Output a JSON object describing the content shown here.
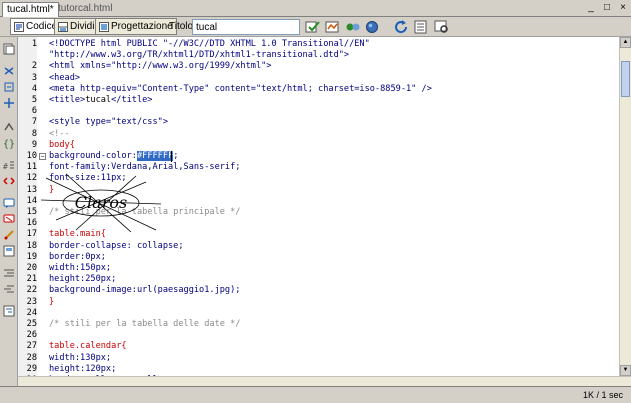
{
  "tabs": [
    {
      "label": "tucal.html*",
      "active": true
    },
    {
      "label": "tutorcal.html",
      "active": false
    }
  ],
  "window_buttons": [
    "_",
    "□",
    "×"
  ],
  "toolbar": {
    "code_label": "Codice",
    "split_label": "Dividi",
    "design_label": "Progettazione",
    "title_label": "Titolo:",
    "title_value": "tucal"
  },
  "editor": {
    "lines": [
      {
        "n": "1",
        "parts": [
          {
            "t": "<!DOCTYPE html PUBLIC \"-//W3C//DTD XHTML 1.0 Transitional//EN\"",
            "c": "tag"
          }
        ]
      },
      {
        "n": "",
        "parts": [
          {
            "t": "\"http://www.w3.org/TR/xhtml1/DTD/xhtml1-transitional.dtd\">",
            "c": "tag"
          }
        ]
      },
      {
        "n": "2",
        "parts": [
          {
            "t": "<html xmlns=\"http://www.w3.org/1999/xhtml\">",
            "c": "tag"
          }
        ]
      },
      {
        "n": "3",
        "parts": [
          {
            "t": "<head>",
            "c": "tag"
          }
        ]
      },
      {
        "n": "4",
        "parts": [
          {
            "t": "<meta http-equiv=\"Content-Type\" content=\"text/html; charset=iso-8859-1\" />",
            "c": "tag"
          }
        ]
      },
      {
        "n": "5",
        "parts": [
          {
            "t": "<title>",
            "c": "tag"
          },
          {
            "t": "tucal",
            "c": "txt"
          },
          {
            "t": "</title>",
            "c": "tag"
          }
        ]
      },
      {
        "n": "6",
        "parts": []
      },
      {
        "n": "7",
        "parts": [
          {
            "t": "<style type=\"text/css\">",
            "c": "tag"
          }
        ]
      },
      {
        "n": "8",
        "parts": [
          {
            "t": "<!--",
            "c": "cm"
          }
        ]
      },
      {
        "n": "9",
        "parts": [
          {
            "t": "body{",
            "c": "css"
          }
        ]
      },
      {
        "n": "10",
        "fold": true,
        "parts": [
          {
            "t": "background-color:",
            "c": "prop"
          },
          {
            "t": "#FFFFFF",
            "c": "sel"
          },
          {
            "t": ";",
            "c": "prop"
          }
        ]
      },
      {
        "n": "11",
        "parts": [
          {
            "t": "font-family:Verdana,Arial,Sans-serif;",
            "c": "prop"
          }
        ]
      },
      {
        "n": "12",
        "parts": [
          {
            "t": "font-size:11px;",
            "c": "prop"
          }
        ]
      },
      {
        "n": "13",
        "parts": [
          {
            "t": "}",
            "c": "css"
          }
        ]
      },
      {
        "n": "14",
        "parts": []
      },
      {
        "n": "15",
        "parts": [
          {
            "t": "/* stili per la tabella principale */",
            "c": "cm"
          }
        ]
      },
      {
        "n": "16",
        "parts": []
      },
      {
        "n": "17",
        "parts": [
          {
            "t": "table.main{",
            "c": "css"
          }
        ]
      },
      {
        "n": "18",
        "parts": [
          {
            "t": "border-collapse: collapse;",
            "c": "prop"
          }
        ]
      },
      {
        "n": "19",
        "parts": [
          {
            "t": "border:0px;",
            "c": "prop"
          }
        ]
      },
      {
        "n": "20",
        "parts": [
          {
            "t": "width:150px;",
            "c": "prop"
          }
        ]
      },
      {
        "n": "21",
        "parts": [
          {
            "t": "height:250px;",
            "c": "prop"
          }
        ]
      },
      {
        "n": "22",
        "parts": [
          {
            "t": "background-image:url(paesaggio1.jpg);",
            "c": "prop"
          }
        ]
      },
      {
        "n": "23",
        "parts": [
          {
            "t": "}",
            "c": "css"
          }
        ]
      },
      {
        "n": "24",
        "parts": []
      },
      {
        "n": "25",
        "parts": [
          {
            "t": "/* stili per la tabella delle date */",
            "c": "cm"
          }
        ]
      },
      {
        "n": "26",
        "parts": []
      },
      {
        "n": "27",
        "parts": [
          {
            "t": "table.calendar{",
            "c": "css"
          }
        ]
      },
      {
        "n": "28",
        "parts": [
          {
            "t": "width:130px;",
            "c": "prop"
          }
        ]
      },
      {
        "n": "29",
        "parts": [
          {
            "t": "height:120px;",
            "c": "prop"
          }
        ]
      },
      {
        "n": "30",
        "parts": [
          {
            "t": "border-collapse: collapse;",
            "c": "prop"
          }
        ]
      }
    ]
  },
  "watermark": {
    "text": "Claros"
  },
  "status": {
    "text": "1K / 1 sec"
  },
  "colors": {
    "chrome": "#d4d0c8",
    "tag": "#000080",
    "css": "#cc0000",
    "comment": "#8a8a8a",
    "selection": "#316ac5"
  }
}
